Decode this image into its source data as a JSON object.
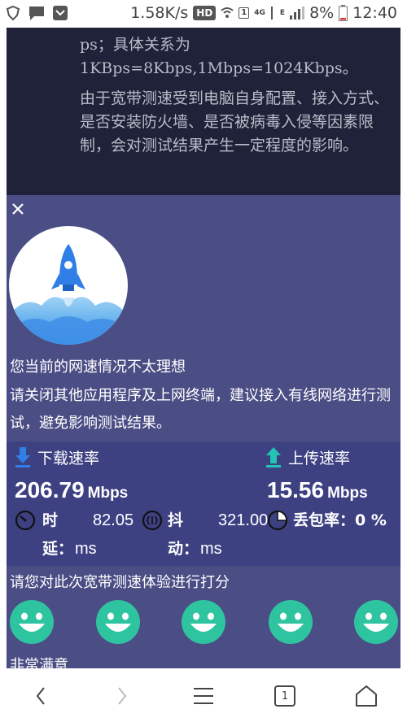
{
  "status_bar": {
    "speed": "1.58K/s",
    "hd_badge": "HD",
    "sim": "1",
    "network_4g": "4G",
    "network_e": "E",
    "battery": "8%",
    "time": "12:40"
  },
  "article": {
    "para1": "ps；具体关系为1KBps=8Kbps,1Mbps=1024Kbps。",
    "para2": "由于宽带测速受到电脑自身配置、接入方式、是否安装防火墙、是否被病毒入侵等因素限制，会对测试结果产生一定程度的影响。"
  },
  "panel": {
    "message_title": "您当前的网速情况不太理想",
    "message_body": "请关闭其他应用程序及上网终端，建议接入有线网络进行测试，避免影响测试结果。",
    "download": {
      "label": "下载速率",
      "value": "206.79",
      "unit": "Mbps"
    },
    "upload": {
      "label": "上传速率",
      "value": "15.56",
      "unit": "Mbps"
    },
    "latency": {
      "label_top": "时",
      "label_bottom": "延：",
      "value": "82.05",
      "unit": "ms"
    },
    "jitter": {
      "label_top": "抖",
      "label_bottom": "动：",
      "value": "321.00",
      "unit": "ms"
    },
    "loss": {
      "label": "丢包率：",
      "value": "0 %"
    },
    "rating_prompt": "请您对此次宽带测速体验进行打分",
    "rating_label": "非常满意"
  },
  "colors": {
    "article_bg": "#1f2238",
    "panel_bg": "#4b4e85",
    "stats_bg": "#3d4182",
    "face": "#2ec4a0",
    "icon_blue": "#2f7fe6",
    "icon_teal": "#22c4b4"
  },
  "icons": [
    "close-icon",
    "rocket-logo",
    "download-arrow-icon",
    "upload-arrow-icon",
    "latency-gauge-icon",
    "jitter-icon",
    "packet-loss-pie-icon",
    "smiley-face-icon",
    "back-icon",
    "forward-icon",
    "menu-icon",
    "tabs-icon",
    "home-icon"
  ],
  "navbar": {
    "tab_count": "1"
  }
}
